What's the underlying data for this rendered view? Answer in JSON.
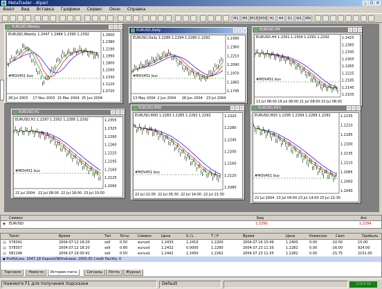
{
  "app": {
    "title": "MetaTrader - Alpari"
  },
  "menu": [
    "Файл",
    "Вид",
    "Вставка",
    "Графики",
    "Сервис",
    "Окно",
    "Справка"
  ],
  "toolbar": {
    "timeframes": [
      "M1",
      "M5",
      "M15",
      "M30",
      "H1",
      "H4",
      "D1",
      "W1",
      "MN"
    ]
  },
  "charts": [
    {
      "title": "EURUSD,Weekly",
      "label": "EURUSD,Weekly 1.2447 1.2484 1.2390 1.2392",
      "prices": [
        "1.2600",
        "1.2380",
        "1.2190",
        "1.1990",
        "1.1800",
        "1.1560",
        "1.1330",
        "1.1120",
        "1.0720"
      ],
      "times": [
        "28 Jul 2003",
        "17 Nov 2003",
        "15 Mar 2004",
        "25 Jun 2004"
      ],
      "ind": "#MOV451 bus"
    },
    {
      "title": "EURUSD,Daily",
      "label": "EURUSD,Daily 1.2289 1.2294 1.2280 1.2292",
      "prices": [
        "1.2390",
        "1.2360",
        "1.2210",
        "1.2090",
        "1.1970",
        "1.1865",
        "1.1745"
      ],
      "times": [
        "13 May 2004",
        "2 Jun 2004",
        "28 Jun 2004",
        "23 Jul 2004"
      ],
      "ind": "#MOV451 bus"
    },
    {
      "title": "EURUSD,H4",
      "label": "EURUSD,H4 1.2301 1.2304 1.2292 1.2292",
      "prices": [
        "1.2425",
        "1.2385",
        "1.2345",
        "1.2305",
        "1.2265",
        "1.2225",
        "1.2185",
        "1.2145",
        "1.2105"
      ],
      "times": [
        "13 Jul 08:00",
        "16 Jul 08:00",
        "21 Jul 08:00",
        "23 Jul 08:00"
      ],
      "ind": "#MOV451 bus"
    },
    {
      "title": "EURUSD,H1",
      "label": "EURUSD,H1 1.2297 1.2302 1.2288 1.2292",
      "prices": [
        "1.2355",
        "1.2325",
        "1.2290",
        "1.2260",
        "1.2225",
        "1.2195",
        "1.2160",
        "1.2125",
        "1.2090"
      ],
      "times": [
        "21 Jul 2004",
        "22 Jul 08:00",
        "22 Jul 18:00",
        "23 Jul 10:00"
      ],
      "ind": "#MOV451 bus"
    },
    {
      "title": "EURUSD,M30",
      "label": "EURUSD,M30 1.2283 1.2285 1.2292 1.2292",
      "prices": [
        "1.2320",
        "1.2280",
        "1.2240",
        "1.2200",
        "1.2160",
        "1.2120",
        "1.2080"
      ],
      "times": [
        "22 Jul 22:00",
        "22 Jul 05:30",
        "22 Jul 14:00",
        "22 Jul 21:30"
      ],
      "ind": "#MOV451 bus"
    },
    {
      "title": "EURUSD,M15",
      "label": "EURUSD,M15 1.2295 1.2299 1.2289 1.2292",
      "prices": [
        "1.2235",
        "1.2210",
        "1.2185",
        "1.2160",
        "1.2135",
        "1.2110",
        "1.2085",
        "1.2060",
        "1.2040"
      ],
      "times": [
        "22 Jul 2004",
        "23 Jul 04:00",
        "23 Jul 14:00",
        "23 Jul 22:30"
      ],
      "ind": "#MOV451 bus"
    }
  ],
  "quotes": {
    "headers": [
      "Символ",
      "Бид",
      "Аск"
    ],
    "rows": [
      {
        "symbol": "EURUSD",
        "bid": "1.2290",
        "ask": "1.2294"
      }
    ]
  },
  "terminal": {
    "headers": [
      "Тикет",
      "Время",
      "Тип",
      "Лоты",
      "Символ",
      "Цена",
      "S / L",
      "T / P",
      "Время",
      "Цена",
      "Комиссия",
      "Своп",
      "Прибыль"
    ],
    "rows": [
      [
        "578341",
        "2004.07.12 18:20",
        "sell",
        "0.50",
        "eurusd",
        "1.2433",
        "1.2410",
        "1.2200",
        "2004.07.16 15:49",
        "1.2400",
        "0.00",
        "-10.50",
        "15.00"
      ],
      [
        "578357",
        "2004.07.12 18:20",
        "sell",
        "0.80",
        "eurusd",
        "1.2432",
        "0.0000",
        "1.2280",
        "2004.07.23 11:35",
        "1.2282",
        "0.00",
        "-16.00",
        "924.00"
      ],
      [
        "581146",
        "2004.07.16 00:42",
        "sell",
        "0.50",
        "eurusd",
        "1.2441",
        "1.2450",
        "1.2262",
        "2004.07.23 11:35",
        "1.2282",
        "0.00",
        "-15.75",
        "2151.00"
      ]
    ],
    "total": "Profit/Loss: 3047.18  Deposit/Withdrawal: 2000.00  Credit Facility: 0",
    "tabs": [
      "Торговля",
      "Новости",
      "История счета",
      "Сигналы",
      "Почта",
      "Журнал"
    ]
  },
  "status": {
    "help": "Нажмите F1 для получения подсказки",
    "profile": "Default",
    "conn": "116/4 kb"
  }
}
